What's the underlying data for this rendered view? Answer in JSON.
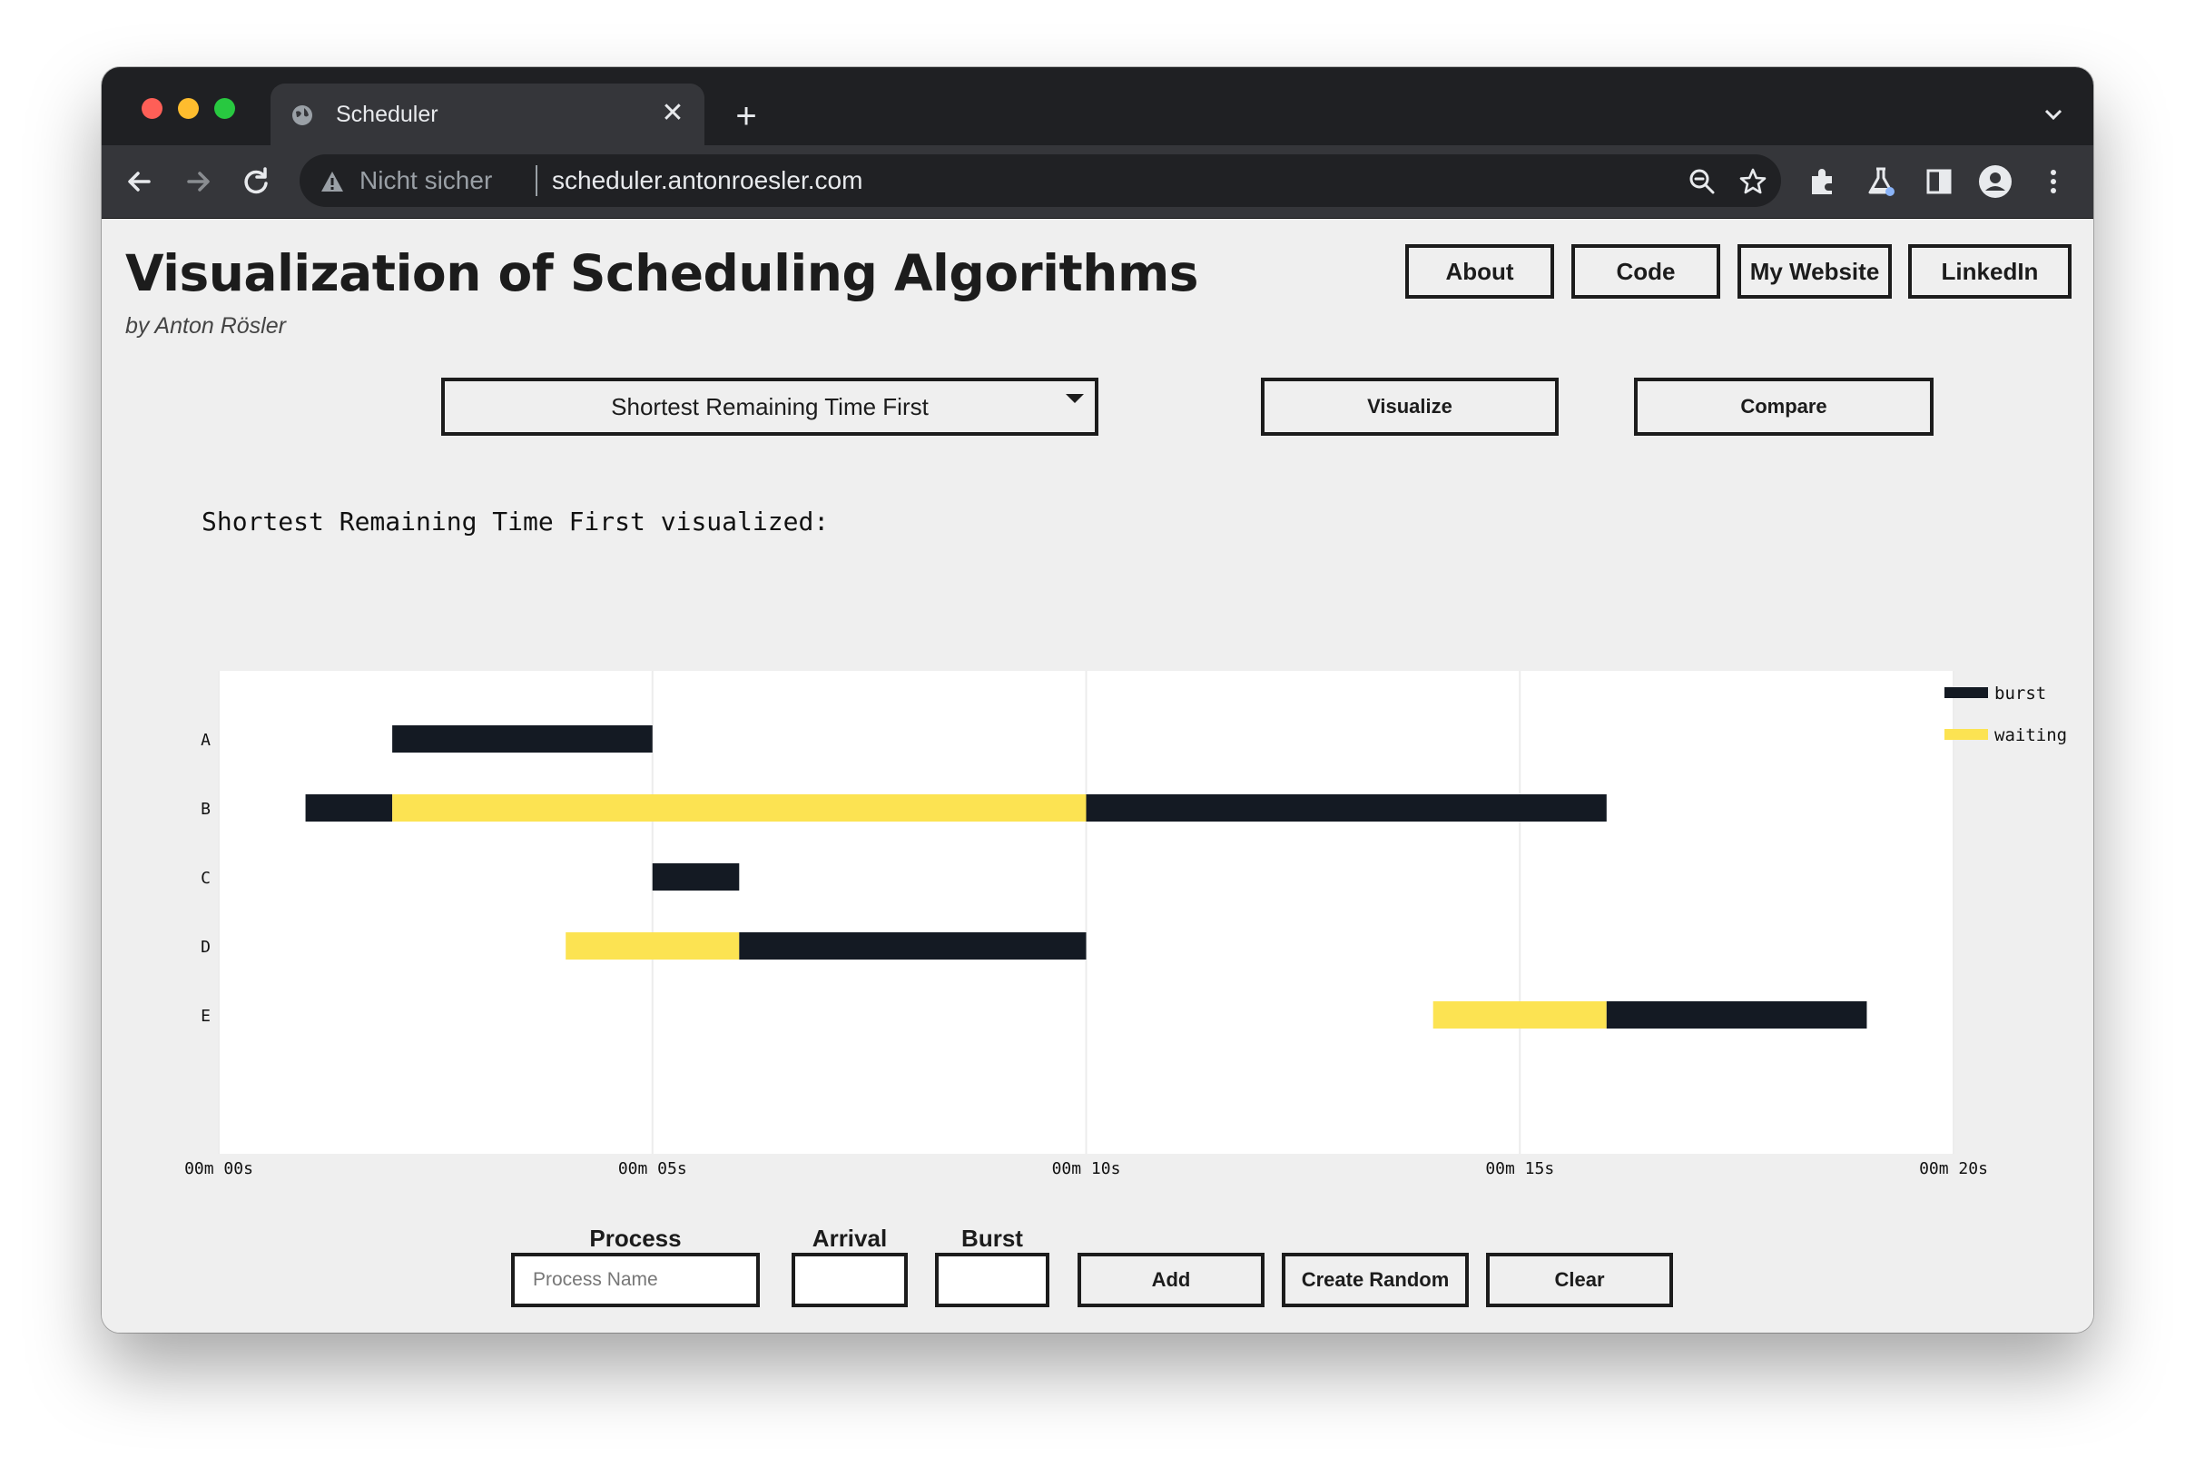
{
  "browser": {
    "tab_title": "Scheduler",
    "new_tab_symbol": "+",
    "close_symbol": "✕",
    "security_label": "Nicht sicher",
    "url": "scheduler.antonroesler.com"
  },
  "header": {
    "title": "Visualization of Scheduling Algorithms",
    "byline": "by Anton Rösler",
    "nav": [
      "About",
      "Code",
      "My Website",
      "LinkedIn"
    ]
  },
  "controls": {
    "algorithm_selected": "Shortest Remaining Time First",
    "visualize_label": "Visualize",
    "compare_label": "Compare"
  },
  "visualization_title": "Shortest Remaining Time First visualized:",
  "colors": {
    "burst": "#141a23",
    "waiting": "#fce352"
  },
  "chart_data": {
    "type": "gantt",
    "x_unit": "seconds",
    "xlim": [
      0,
      20
    ],
    "x_ticks": [
      "00m 00s",
      "00m 05s",
      "00m 10s",
      "00m 15s",
      "00m 20s"
    ],
    "categories": [
      "A",
      "B",
      "C",
      "D",
      "E"
    ],
    "legend": [
      "burst",
      "waiting"
    ],
    "legend_position": "top-right",
    "grid": true,
    "segments": [
      {
        "process": "A",
        "kind": "burst",
        "start": 2,
        "end": 5
      },
      {
        "process": "B",
        "kind": "burst",
        "start": 1,
        "end": 2
      },
      {
        "process": "B",
        "kind": "waiting",
        "start": 2,
        "end": 10
      },
      {
        "process": "B",
        "kind": "burst",
        "start": 10,
        "end": 16
      },
      {
        "process": "C",
        "kind": "burst",
        "start": 5,
        "end": 6
      },
      {
        "process": "D",
        "kind": "waiting",
        "start": 4,
        "end": 6
      },
      {
        "process": "D",
        "kind": "burst",
        "start": 6,
        "end": 10
      },
      {
        "process": "E",
        "kind": "waiting",
        "start": 14,
        "end": 16
      },
      {
        "process": "E",
        "kind": "burst",
        "start": 16,
        "end": 19
      }
    ]
  },
  "form": {
    "process_label": "Process",
    "arrival_label": "Arrival",
    "burst_label": "Burst",
    "process_placeholder": "Process Name",
    "add_label": "Add",
    "random_label": "Create Random",
    "clear_label": "Clear"
  }
}
